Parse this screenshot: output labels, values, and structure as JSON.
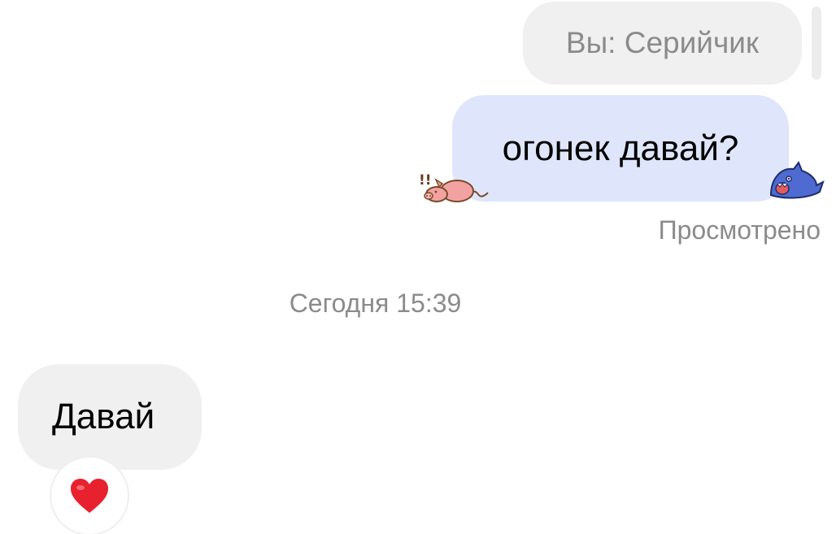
{
  "chat": {
    "reply_preview": "Вы: Серийчик",
    "outgoing_message": "огонек давай?",
    "read_status": "Просмотрено",
    "date_separator": "Сегодня 15:39",
    "incoming_message": "Давай"
  },
  "stickers": {
    "left": "pig-sticker",
    "right": "shark-sticker"
  },
  "reaction": {
    "icon": "red-heart-icon",
    "color": "#e8212f"
  },
  "colors": {
    "outgoing_bubble": "#dfe6fb",
    "incoming_bubble": "#f0f0f0",
    "muted_text": "#8b8b8b"
  }
}
